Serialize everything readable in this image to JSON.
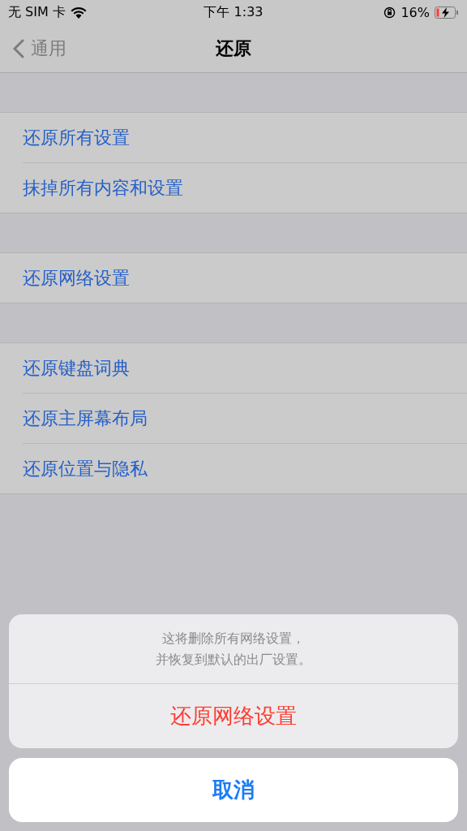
{
  "status_bar": {
    "carrier": "无 SIM 卡",
    "time": "下午 1:33",
    "battery": "16%"
  },
  "nav": {
    "back": "通用",
    "title": "还原"
  },
  "groups": [
    {
      "items": [
        "还原所有设置",
        "抹掉所有内容和设置"
      ]
    },
    {
      "items": [
        "还原网络设置"
      ]
    },
    {
      "items": [
        "还原键盘词典",
        "还原主屏幕布局",
        "还原位置与隐私"
      ]
    }
  ],
  "action_sheet": {
    "message": [
      "这将删除所有网络设置，",
      "并恢复到默认的出厂设置。"
    ],
    "actions": [
      {
        "label": "还原网络设置",
        "kind": "destructive"
      }
    ],
    "cancel": "取消"
  }
}
